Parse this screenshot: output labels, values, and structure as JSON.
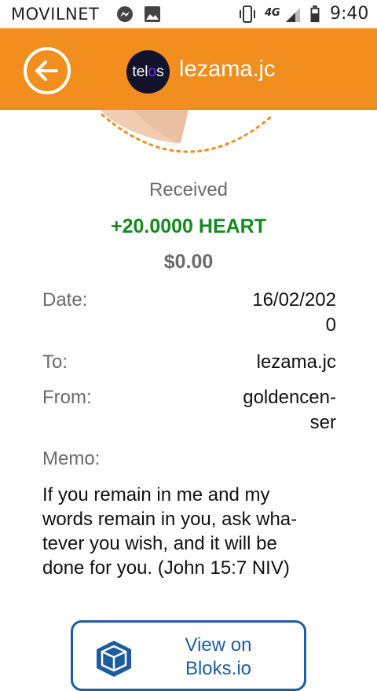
{
  "status_bar": {
    "carrier": "MOVILNET",
    "network": "4G",
    "time": "9:40",
    "icons": [
      "messenger-icon",
      "image-icon",
      "vibrate-icon",
      "signal-icon",
      "battery-icon"
    ]
  },
  "app_bar": {
    "logo_text_left": "tel",
    "logo_text_dot": "o",
    "logo_text_right": "s",
    "title": "lezama.jc",
    "back_icon": "back-arrow-icon"
  },
  "transaction": {
    "status": "Received",
    "amount": "+20.0000 HEART",
    "usd_value": "$0.00",
    "date_label": "Date:",
    "date_line1": "16/02/202",
    "date_line2": "0",
    "to_label": "To:",
    "to_value": "lezama.jc",
    "from_label": "From:",
    "from_line1": "goldencen-",
    "from_line2": "ser",
    "memo_label": "Memo:",
    "memo_lines": [
      "If you remain in me and my",
      "words remain in you, ask wha-",
      "tever you wish, and it will be",
      "done for you. (John 15:7 NIV)"
    ]
  },
  "bloks_button": {
    "line1": "View on",
    "line2": "Bloks.io",
    "icon": "cube-icon"
  },
  "colors": {
    "app_bar": "#f18e1e",
    "amount": "#138a1e",
    "link": "#1d5d9e"
  }
}
